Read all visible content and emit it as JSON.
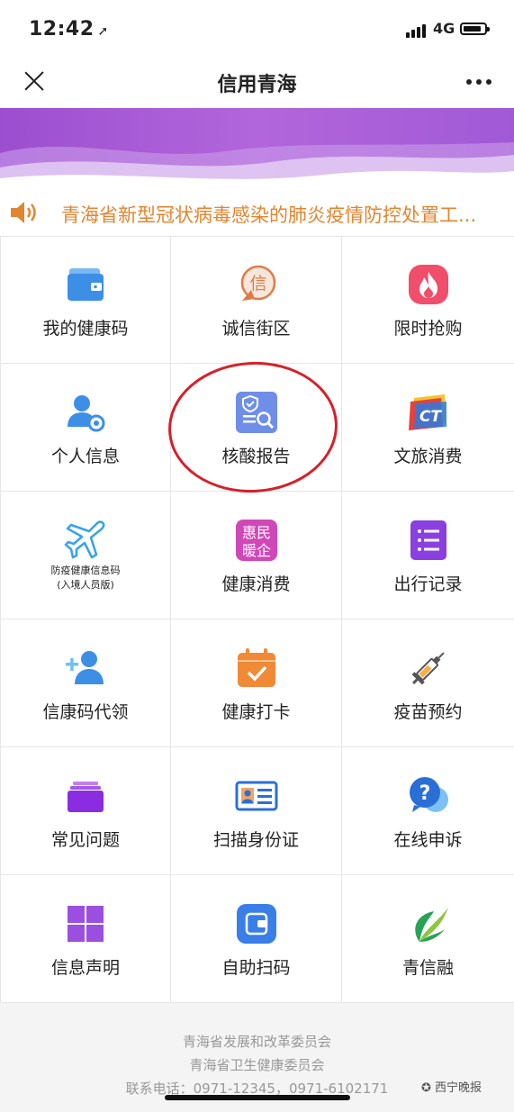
{
  "status_bar": {
    "time": "12:42",
    "network": "4G",
    "battery_level": 0.85
  },
  "navbar": {
    "title": "信用青海"
  },
  "notice": {
    "text": "青海省新型冠状病毒感染的肺炎疫情防控处置工..."
  },
  "grid": [
    {
      "label": "我的健康码",
      "icon": "wallet-icon"
    },
    {
      "label": "诚信街区",
      "icon": "credit-badge-icon",
      "glyph": "信"
    },
    {
      "label": "限时抢购",
      "icon": "flame-icon"
    },
    {
      "label": "个人信息",
      "icon": "user-settings-icon"
    },
    {
      "label": "核酸报告",
      "icon": "shield-search-icon"
    },
    {
      "label": "文旅消费",
      "icon": "culture-tourism-icon",
      "glyph": "CT"
    },
    {
      "label": "防疫健康信息码",
      "sublabel": "(入境人员版)",
      "icon": "airplane-icon"
    },
    {
      "label": "健康消费",
      "icon": "benefit-icon",
      "glyph_lines": [
        "惠民",
        "暖企"
      ]
    },
    {
      "label": "出行记录",
      "icon": "list-icon"
    },
    {
      "label": "信康码代领",
      "icon": "add-user-icon"
    },
    {
      "label": "健康打卡",
      "icon": "calendar-check-icon"
    },
    {
      "label": "疫苗预约",
      "icon": "syringe-icon"
    },
    {
      "label": "常见问题",
      "icon": "stack-icon"
    },
    {
      "label": "扫描身份证",
      "icon": "id-card-icon"
    },
    {
      "label": "在线申诉",
      "icon": "question-bubble-icon"
    },
    {
      "label": "信息声明",
      "icon": "grid-squares-icon"
    },
    {
      "label": "自助扫码",
      "icon": "scan-wallet-icon"
    },
    {
      "label": "青信融",
      "icon": "leaf-logo-icon"
    }
  ],
  "footer": {
    "line1": "青海省发展和改革委员会",
    "line2": "青海省卫生健康委员会",
    "line3": "联系电话：0971-12345，0971-6102171"
  },
  "watermark": "西宁晚报",
  "colors": {
    "banner": "#a65ad6",
    "notice": "#e2852f",
    "highlight_circle": "#d6202a"
  }
}
